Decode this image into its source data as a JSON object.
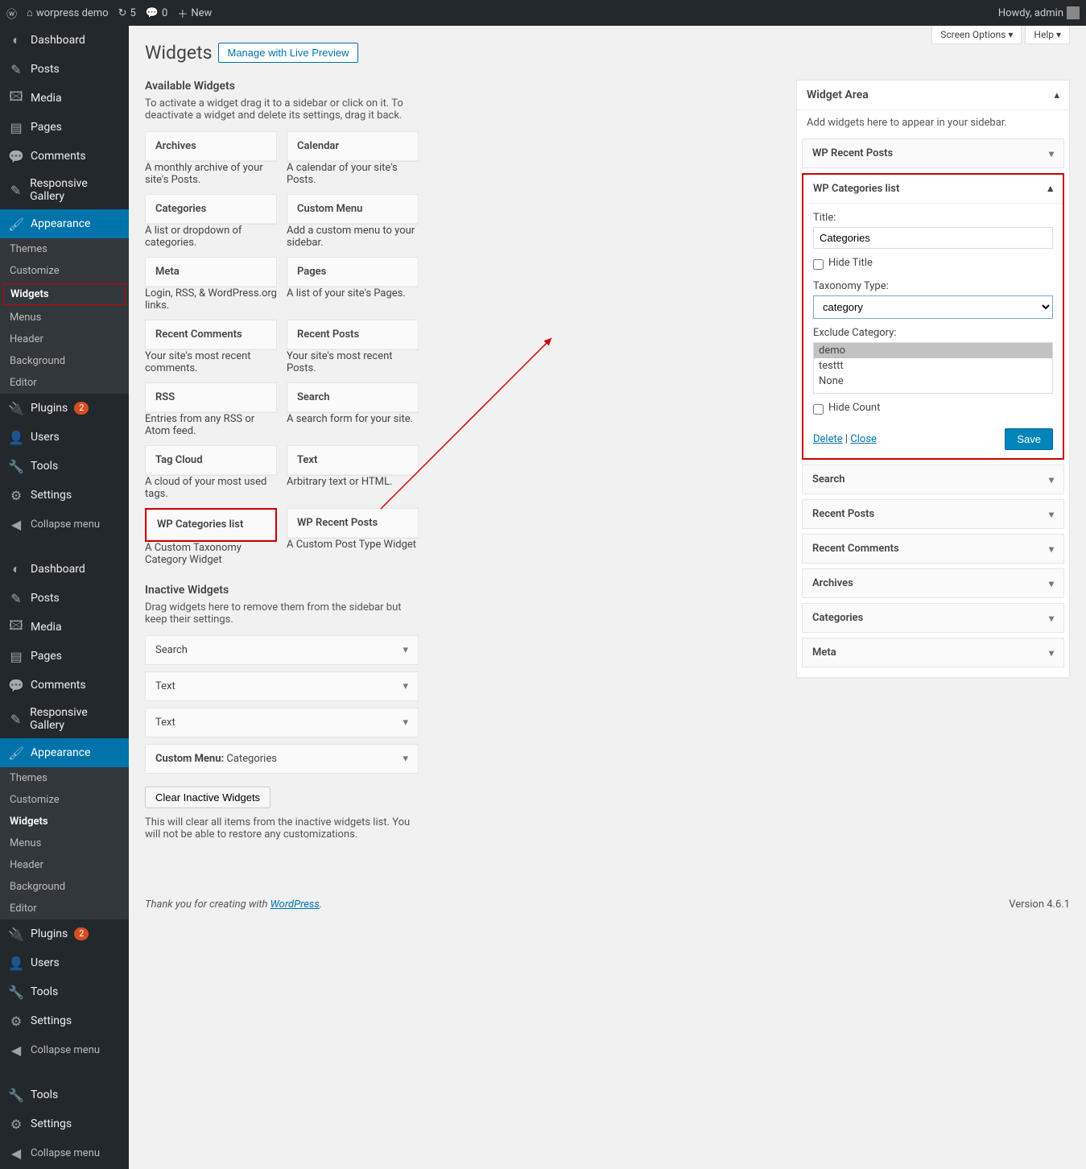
{
  "adminbar": {
    "site": "worpress demo",
    "updates": "5",
    "comments": "0",
    "new": "New",
    "howdy": "Howdy, admin"
  },
  "top": {
    "screen_options": "Screen Options ▾",
    "help": "Help ▾"
  },
  "page": {
    "title": "Widgets",
    "manage": "Manage with Live Preview"
  },
  "sidebarA": {
    "dashboard": "Dashboard",
    "posts": "Posts",
    "media": "Media",
    "pages": "Pages",
    "comments": "Comments",
    "gallery": "Responsive Gallery",
    "appearance": "Appearance",
    "sub": {
      "themes": "Themes",
      "customize": "Customize",
      "widgets": "Widgets",
      "menus": "Menus",
      "header": "Header",
      "background": "Background",
      "editor": "Editor"
    },
    "plugins": "Plugins",
    "plugins_badge": "2",
    "users": "Users",
    "tools": "Tools",
    "settings": "Settings",
    "collapse": "Collapse menu"
  },
  "available": {
    "heading": "Available Widgets",
    "desc": "To activate a widget drag it to a sidebar or click on it. To deactivate a widget and delete its settings, drag it back.",
    "widgets": [
      {
        "t": "Archives",
        "d": "A monthly archive of your site's Posts."
      },
      {
        "t": "Calendar",
        "d": "A calendar of your site's Posts."
      },
      {
        "t": "Categories",
        "d": "A list or dropdown of categories."
      },
      {
        "t": "Custom Menu",
        "d": "Add a custom menu to your sidebar."
      },
      {
        "t": "Meta",
        "d": "Login, RSS, & WordPress.org links."
      },
      {
        "t": "Pages",
        "d": "A list of your site's Pages."
      },
      {
        "t": "Recent Comments",
        "d": "Your site's most recent comments."
      },
      {
        "t": "Recent Posts",
        "d": "Your site's most recent Posts."
      },
      {
        "t": "RSS",
        "d": "Entries from any RSS or Atom feed."
      },
      {
        "t": "Search",
        "d": "A search form for your site."
      },
      {
        "t": "Tag Cloud",
        "d": "A cloud of your most used tags."
      },
      {
        "t": "Text",
        "d": "Arbitrary text or HTML."
      },
      {
        "t": "WP Categories list",
        "d": "A Custom Taxonomy Category Widget"
      },
      {
        "t": "WP Recent Posts",
        "d": "A Custom Post Type Widget"
      }
    ]
  },
  "inactive": {
    "heading": "Inactive Widgets",
    "desc": "Drag widgets here to remove them from the sidebar but keep their settings.",
    "items": [
      "Search",
      "Text",
      "Text"
    ],
    "custom_menu_label": "Custom Menu:",
    "custom_menu_value": "Categories",
    "clear": "Clear Inactive Widgets",
    "clear_desc": "This will clear all items from the inactive widgets list. You will not be able to restore any customizations."
  },
  "area": {
    "title": "Widget Area",
    "desc": "Add widgets here to appear in your sidebar.",
    "rows_top": [
      "WP Recent Posts"
    ],
    "open": {
      "title": "WP Categories list",
      "fields": {
        "title_label": "Title:",
        "title_value": "Categories",
        "hide_title": "Hide Title",
        "tax_label": "Taxonomy Type:",
        "tax_value": "category",
        "exclude_label": "Exclude Category:",
        "exclude_options": [
          "demo",
          "testtt",
          "None"
        ],
        "hide_count": "Hide Count",
        "delete": "Delete",
        "close": "Close",
        "save": "Save"
      }
    },
    "rows_bottom": [
      "Search",
      "Recent Posts",
      "Recent Comments",
      "Archives",
      "Categories",
      "Meta"
    ]
  },
  "footer": {
    "thanks": "Thank you for creating with ",
    "wp": "WordPress",
    "dot": ".",
    "version": "Version 4.6.1"
  }
}
